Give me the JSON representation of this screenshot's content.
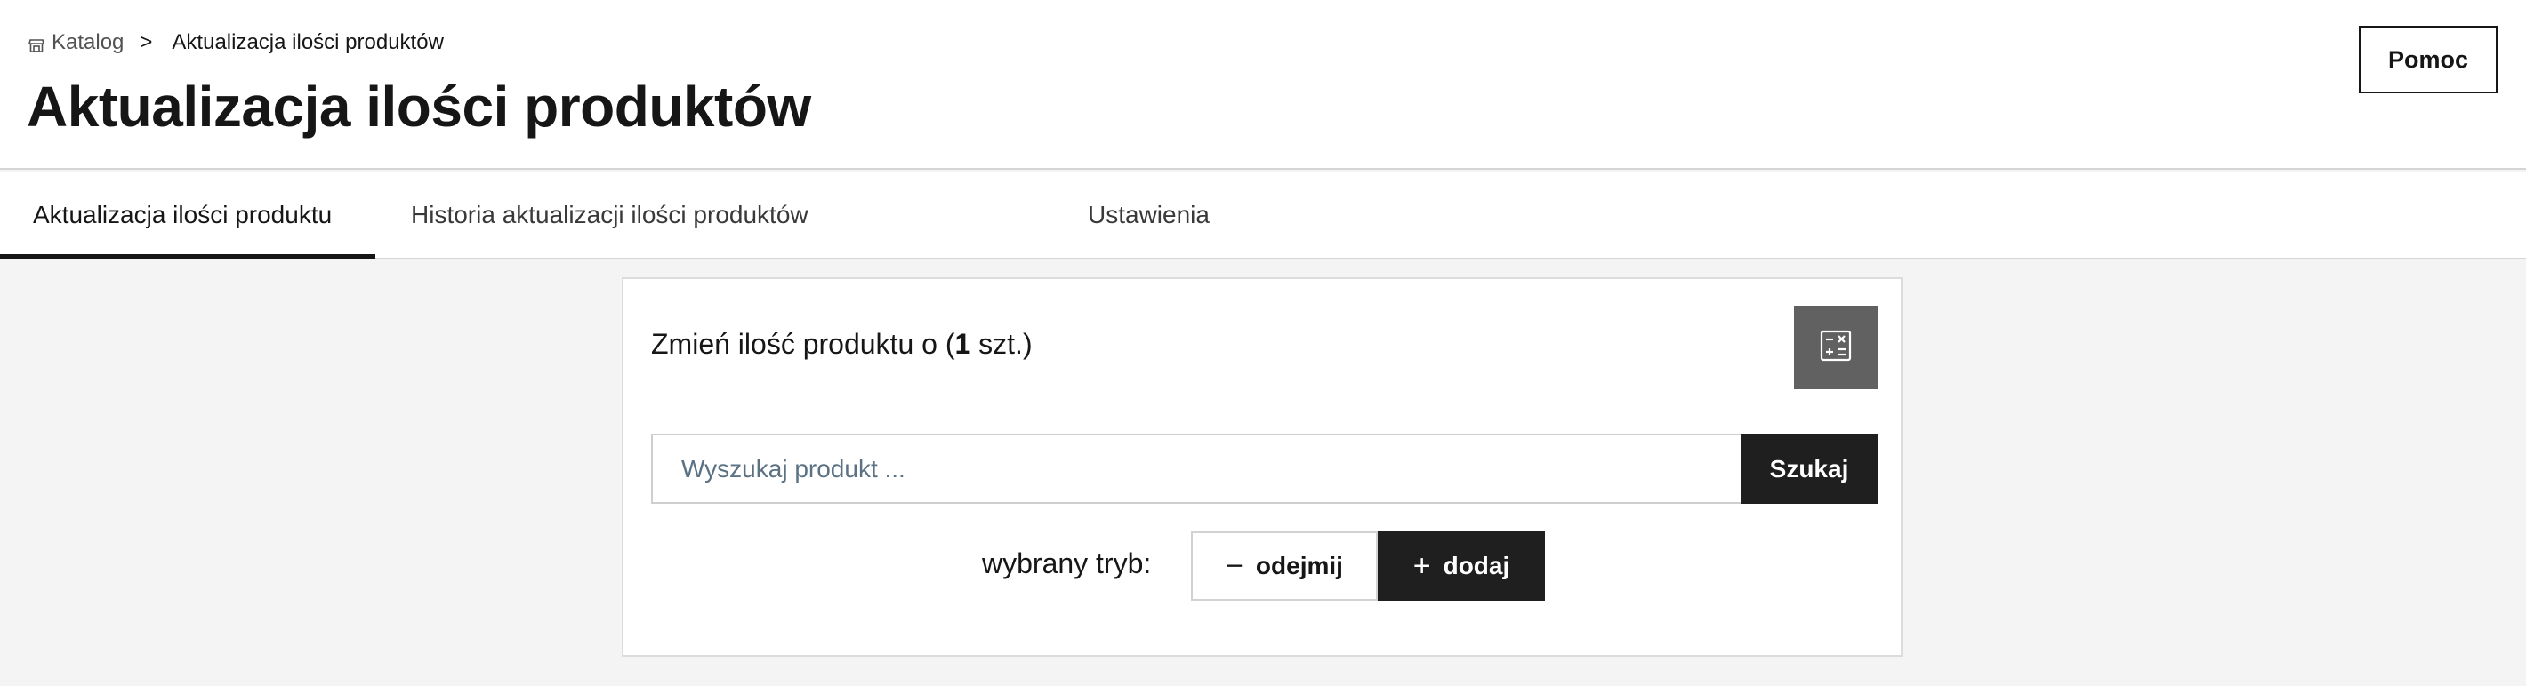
{
  "breadcrumb": {
    "icon": "store-icon",
    "root": "Katalog",
    "separator": ">",
    "current": "Aktualizacja ilości produktów"
  },
  "page": {
    "title": "Aktualizacja ilości produktów",
    "help_label": "Pomoc"
  },
  "tabs": [
    {
      "label": "Aktualizacja ilości produktu",
      "active": true
    },
    {
      "label": "Historia aktualizacji ilości produktów",
      "active": false
    },
    {
      "label": "Ustawienia",
      "active": false
    }
  ],
  "card": {
    "title_prefix": "Zmień ilość produktu o (",
    "quantity": "1",
    "title_suffix": " szt.)",
    "calculator_icon": "calculator-icon",
    "search": {
      "placeholder": "Wyszukaj produkt ...",
      "value": "",
      "button_label": "Szukaj"
    },
    "mode": {
      "label": "wybrany tryb:",
      "subtract": {
        "icon": "minus-icon",
        "symbol": "−",
        "label": "odejmij",
        "selected": false
      },
      "add": {
        "icon": "plus-icon",
        "symbol": "+",
        "label": "dodaj",
        "selected": true
      }
    }
  },
  "colors": {
    "page_background": "#f4f4f4",
    "primary_dark": "#1f1f1f",
    "calculator_button": "#616161",
    "placeholder_text": "#5b7184"
  }
}
